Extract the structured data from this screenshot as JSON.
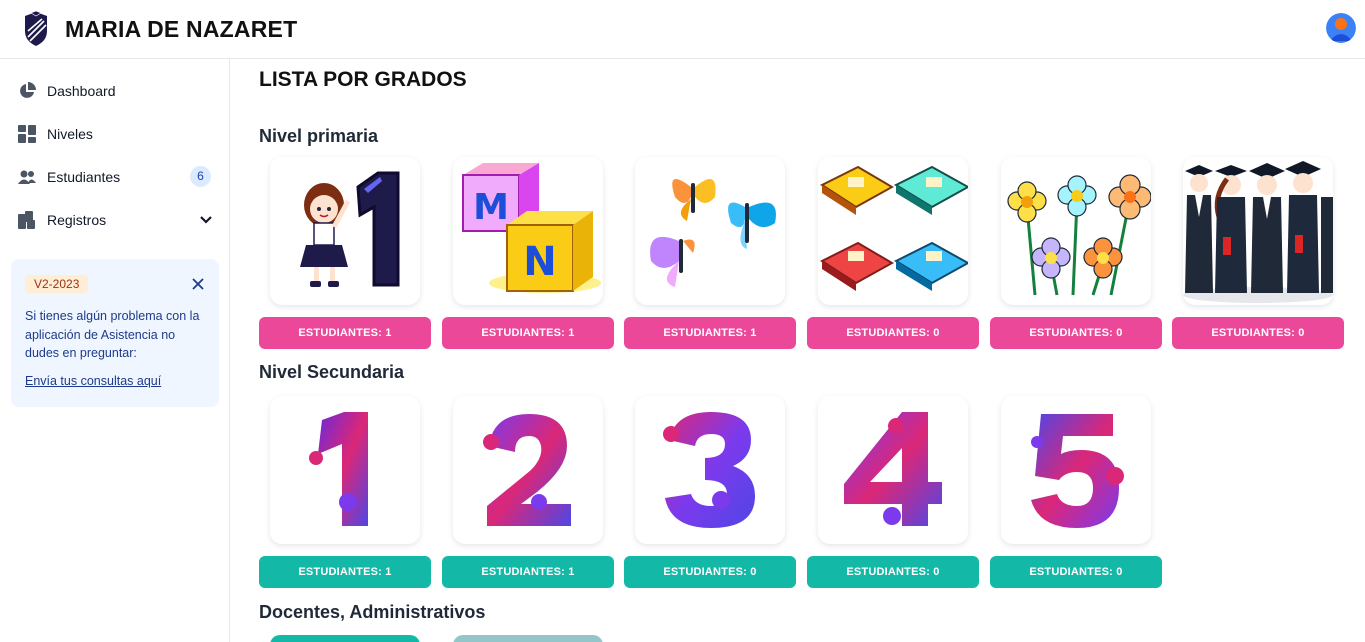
{
  "header": {
    "title": "MARIA DE NAZARET"
  },
  "sidebar": {
    "items": [
      {
        "label": "Dashboard"
      },
      {
        "label": "Niveles"
      },
      {
        "label": "Estudiantes",
        "badge": "6"
      },
      {
        "label": "Registros"
      }
    ],
    "alert": {
      "badge": "V2-2023",
      "text": "Si tienes algún problema con la aplicación de Asistencia no dudes en preguntar:",
      "link": "Envía tus consultas aquí"
    }
  },
  "main": {
    "title": "LISTA POR GRADOS",
    "sections": [
      {
        "title": "Nivel primaria",
        "cards": [
          {
            "label": "ESTUDIANTES: 1"
          },
          {
            "label": "ESTUDIANTES: 1"
          },
          {
            "label": "ESTUDIANTES: 1"
          },
          {
            "label": "ESTUDIANTES: 0"
          },
          {
            "label": "ESTUDIANTES: 0"
          },
          {
            "label": "ESTUDIANTES: 0"
          }
        ]
      },
      {
        "title": "Nivel Secundaria",
        "cards": [
          {
            "label": "ESTUDIANTES: 1"
          },
          {
            "label": "ESTUDIANTES: 1"
          },
          {
            "label": "ESTUDIANTES: 0"
          },
          {
            "label": "ESTUDIANTES: 0"
          },
          {
            "label": "ESTUDIANTES: 0"
          }
        ]
      },
      {
        "title": "Docentes, Administrativos"
      }
    ]
  },
  "colors": {
    "primaria": "#ec4899",
    "secundaria": "#14b8a6",
    "alert_bg": "#eff6ff"
  }
}
